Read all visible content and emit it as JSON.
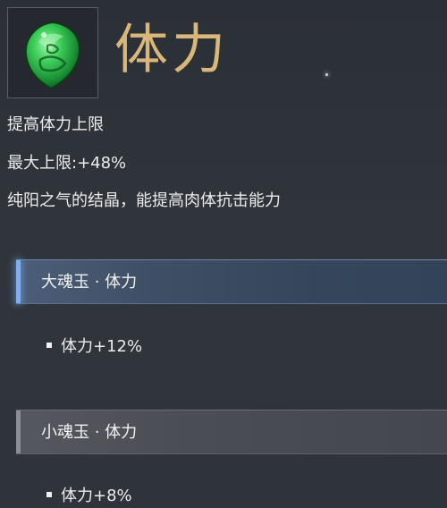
{
  "item": {
    "name": "体力",
    "icon": "green-jade-shield-icon"
  },
  "description": {
    "effect": "提高体力上限",
    "max_cap": "最大上限:+48%",
    "flavor": "纯阳之气的结晶，能提高肉体抗击能力"
  },
  "sets": [
    {
      "name": "大魂玉 · 体力",
      "bonus": "体力+12%"
    },
    {
      "name": "小魂玉 · 体力",
      "bonus": "体力+8%"
    }
  ],
  "colors": {
    "title": "#d9b77a",
    "active_accent": "#7fb0ee",
    "jade": "#2fbf4a"
  }
}
